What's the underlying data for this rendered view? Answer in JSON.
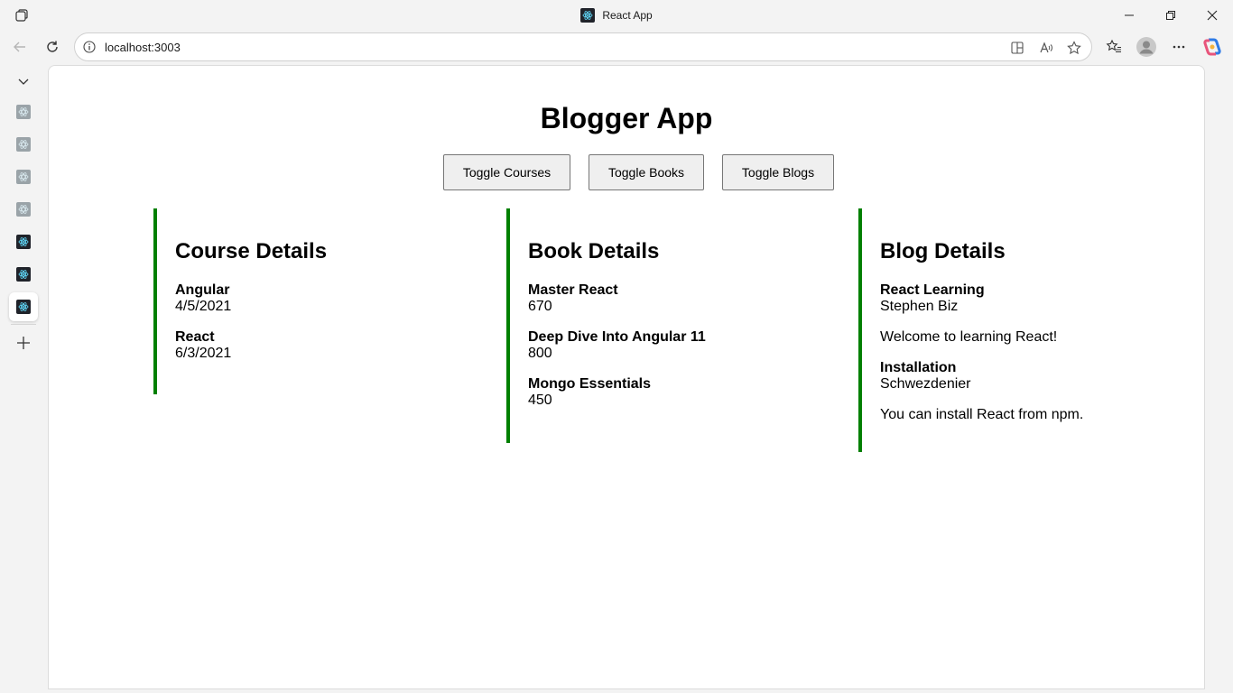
{
  "browser": {
    "tab_title": "React App",
    "url": "localhost:3003"
  },
  "app": {
    "title": "Blogger App",
    "buttons": {
      "courses": "Toggle Courses",
      "books": "Toggle Books",
      "blogs": "Toggle Blogs"
    },
    "courses": {
      "heading": "Course Details",
      "items": [
        {
          "name": "Angular",
          "date": "4/5/2021"
        },
        {
          "name": "React",
          "date": "6/3/2021"
        }
      ]
    },
    "books": {
      "heading": "Book Details",
      "items": [
        {
          "name": "Master React",
          "price": "670"
        },
        {
          "name": "Deep Dive Into Angular 11",
          "price": "800"
        },
        {
          "name": "Mongo Essentials",
          "price": "450"
        }
      ]
    },
    "blogs": {
      "heading": "Blog Details",
      "items": [
        {
          "title": "React Learning",
          "author": "Stephen Biz",
          "content": "Welcome to learning React!"
        },
        {
          "title": "Installation",
          "author": "Schwezdenier",
          "content": "You can install React from npm."
        }
      ]
    }
  },
  "colors": {
    "panel_border": "#008000",
    "button_bg": "#efefef"
  }
}
